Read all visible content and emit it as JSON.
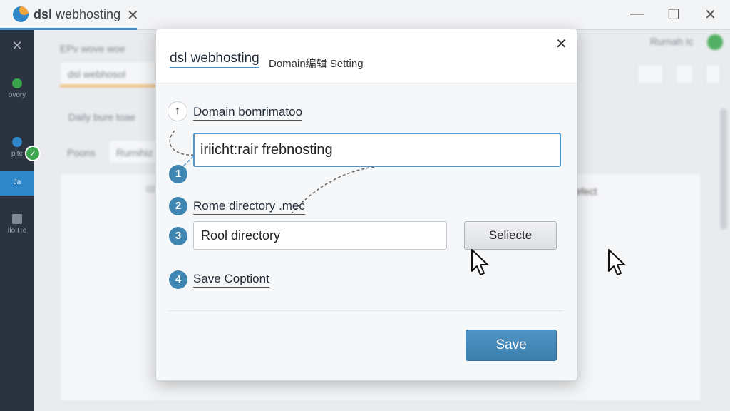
{
  "window": {
    "tab_brand": "dsl",
    "tab_title_rest": " webhosting",
    "tab_close": "✕",
    "minimize": "—",
    "maximize": "☐",
    "close": "✕"
  },
  "sidebar": {
    "items": [
      {
        "label": "ovory"
      },
      {
        "label": "pite"
      },
      {
        "label": "Ja"
      },
      {
        "label": "Ilo ITe"
      }
    ],
    "close_glyph": "✕"
  },
  "background": {
    "section_title": "EPv wove woe",
    "tab_label": "dsl webhosol",
    "row_label": "Daily bure toae",
    "filter_a": "Poons",
    "filter_b": "Rurnihiz",
    "user": "Rurnah Ic",
    "right_text": "lefect"
  },
  "dialog": {
    "title": "dsl webhosting",
    "subtitle": "Domain编辑 Setting",
    "close": "✕",
    "domain_label": "Domain bomrimatoo",
    "domain_value": "iriicht:rair frebnosting",
    "step1": "1",
    "step2": "2",
    "root_label": "Rome directory .mec",
    "step3": "3",
    "root_value": "Rool directory",
    "select_label": "Seliecte",
    "step4": "4",
    "save_option_label": "Save Coptiont",
    "save_label": "Save"
  },
  "colors": {
    "accent": "#3b8fd3",
    "step_badge": "#3f86b3",
    "save_button": "#4589b8",
    "success": "#3aa54c",
    "sidebar_bg": "#2c3340"
  }
}
